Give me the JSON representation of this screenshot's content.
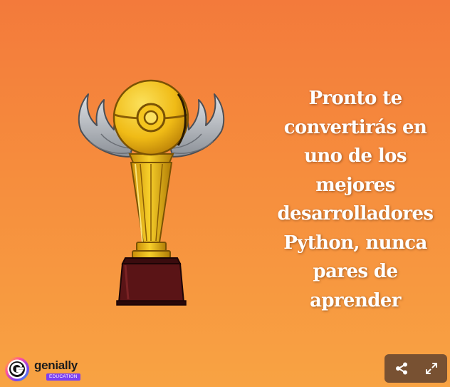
{
  "slide": {
    "message_lines": [
      "Pronto te",
      "convertirás en",
      "uno de los",
      "mejores",
      "desarrolladores",
      "Python, nunca",
      "pares de",
      "aprender"
    ]
  },
  "branding": {
    "name": "genially",
    "badge": "EDUCATION"
  },
  "controls": {
    "share_icon": "share-icon",
    "fullscreen_icon": "fullscreen-icon"
  },
  "colors": {
    "background_top": "#f37a3b",
    "background_bottom": "#f8a343",
    "trophy_gold": "#f2c21a",
    "trophy_base": "#5a1416",
    "badge_purple": "#7b3ff2",
    "controls_bg": "#5c402e"
  }
}
